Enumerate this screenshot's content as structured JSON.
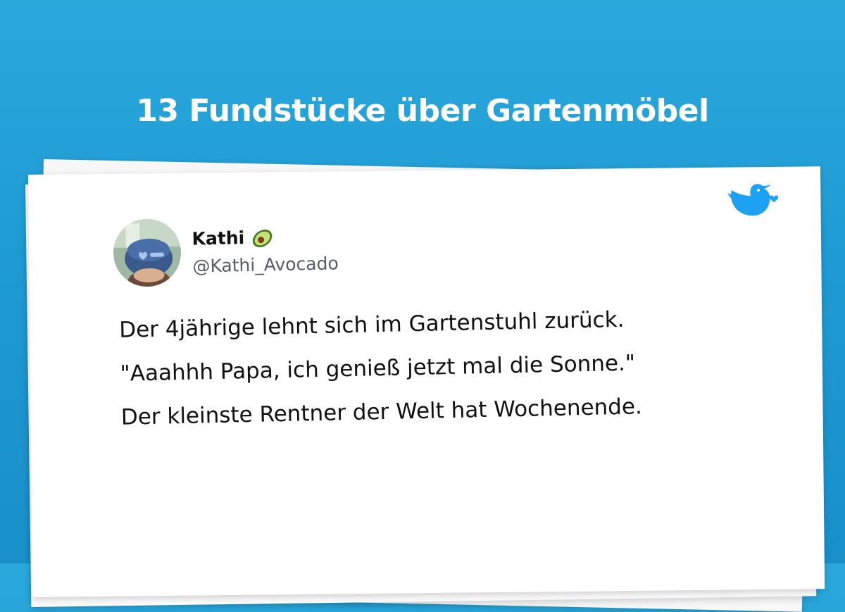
{
  "headline": "13 Fundstücke über Gartenmöbel",
  "tweet": {
    "author_name": "Kathi",
    "author_emoji": "avocado-icon",
    "author_handle": "@Kathi_Avocado",
    "lines": [
      "Der 4jährige lehnt sich im Gartenstuhl zurück.",
      "\"Aaahhh Papa, ich genieß jetzt mal die Sonne.\"",
      "Der kleinste Rentner der Welt hat Wochenende."
    ]
  },
  "icons": {
    "brand": "twitter-bird-icon"
  },
  "colors": {
    "background": "#1f9bd4",
    "bird": "#1da1f2",
    "text": "#111111",
    "handle": "#555d66"
  }
}
